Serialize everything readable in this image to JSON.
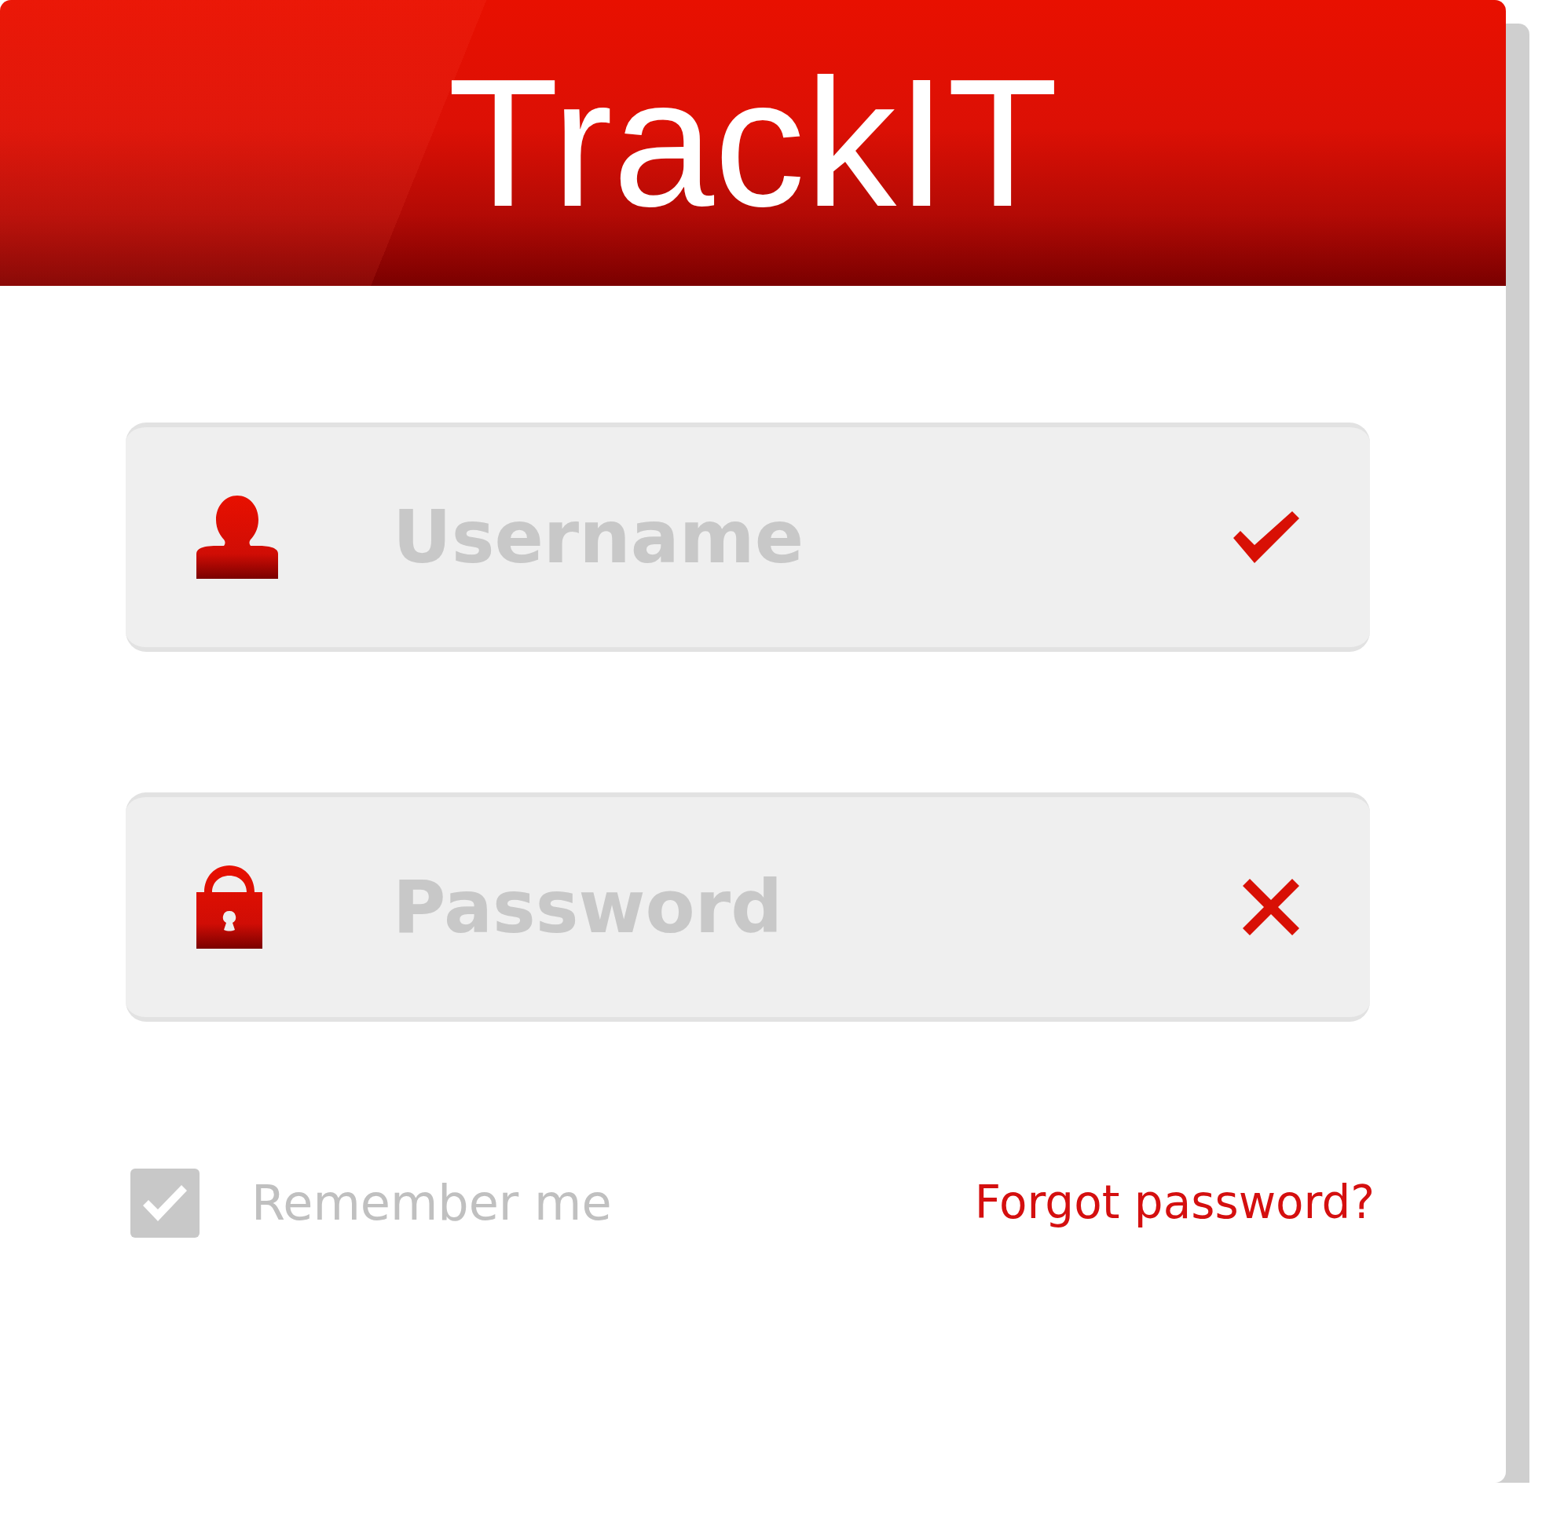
{
  "header": {
    "title": "TrackIT"
  },
  "fields": [
    {
      "kind": "username",
      "placeholder": "Username",
      "valid": true
    },
    {
      "kind": "password",
      "placeholder": "Password",
      "valid": false
    }
  ],
  "remember": {
    "label": "Remember me",
    "checked": true
  },
  "forgot_link": "Forgot password?"
}
